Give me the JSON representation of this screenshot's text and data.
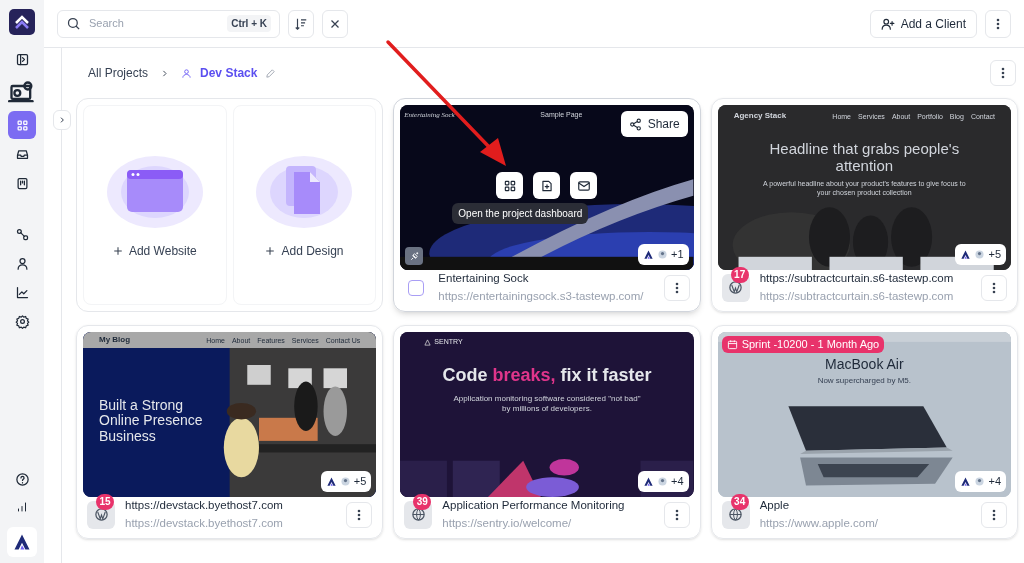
{
  "sidebar": {
    "items": [
      {
        "selected": false
      },
      {
        "selected": false
      },
      {
        "selected": true
      },
      {
        "selected": false
      },
      {
        "selected": false
      },
      {
        "selected": false
      },
      {
        "selected": false
      },
      {
        "selected": false
      },
      {
        "selected": false
      }
    ]
  },
  "search": {
    "placeholder": "Search",
    "shortcut": "Ctrl + K"
  },
  "add_client": "Add a Client",
  "breadcrumb": {
    "root": "All Projects",
    "current": "Dev Stack"
  },
  "add_tiles": [
    {
      "kind": "website",
      "label": "Add Website"
    },
    {
      "kind": "design",
      "label": "Add Design"
    }
  ],
  "projects": [
    {
      "title": "Entertaining Sock",
      "url": "https://entertainingsock.s3-tastewp.com/",
      "hovered": true,
      "checked": false,
      "members_extra": "+1",
      "share": "Share",
      "tooltip": "Open the project dashboard",
      "thumbnail": {
        "kind": "launch",
        "site_name": "Entertaining Sock",
        "nav": [
          "Sample Page"
        ]
      }
    },
    {
      "title": "https://subtractcurtain.s6-tastewp.com",
      "url": "https://subtractcurtain.s6-tastewp.com",
      "hovered": false,
      "kind": "wordpress",
      "badge": "17",
      "members_extra": "+5",
      "thumbnail": {
        "kind": "agency",
        "site_name": "Agency Stack",
        "nav": [
          "Home",
          "Services",
          "About",
          "Portfolio",
          "Blog",
          "Contact"
        ],
        "headline": "Headline that grabs people's attention",
        "subline": "A powerful headline about your product's features to give focus to your chosen product collection"
      }
    },
    {
      "title": "https://devstack.byethost7.com",
      "url": "https://devstack.byethost7.com",
      "hovered": false,
      "kind": "wordpress",
      "badge": "15",
      "members_extra": "+5",
      "thumbnail": {
        "kind": "blog",
        "site_name": "My Blog",
        "nav": [
          "Home",
          "About",
          "Features",
          "Services",
          "Contact Us"
        ],
        "headline": "Built a Strong Online Presence Business"
      }
    },
    {
      "title": "Application Performance Monitoring",
      "url": "https://sentry.io/welcome/",
      "hovered": false,
      "kind": "web",
      "badge": "39",
      "members_extra": "+4",
      "thumbnail": {
        "kind": "sentry",
        "site_name": "SENTRY",
        "headline": "Code **breaks,** fix it faster",
        "subline": "Application monitoring software considered \"not bad\" by millions of developers."
      }
    },
    {
      "title": "Apple",
      "url": "https://www.apple.com/",
      "hovered": false,
      "kind": "web",
      "badge": "34",
      "members_extra": "+4",
      "sprint": "Sprint -10200 - 1 Month Ago",
      "thumbnail": {
        "kind": "apple",
        "headline": "MacBook Air",
        "subline": "Now supercharged by M5."
      }
    }
  ]
}
